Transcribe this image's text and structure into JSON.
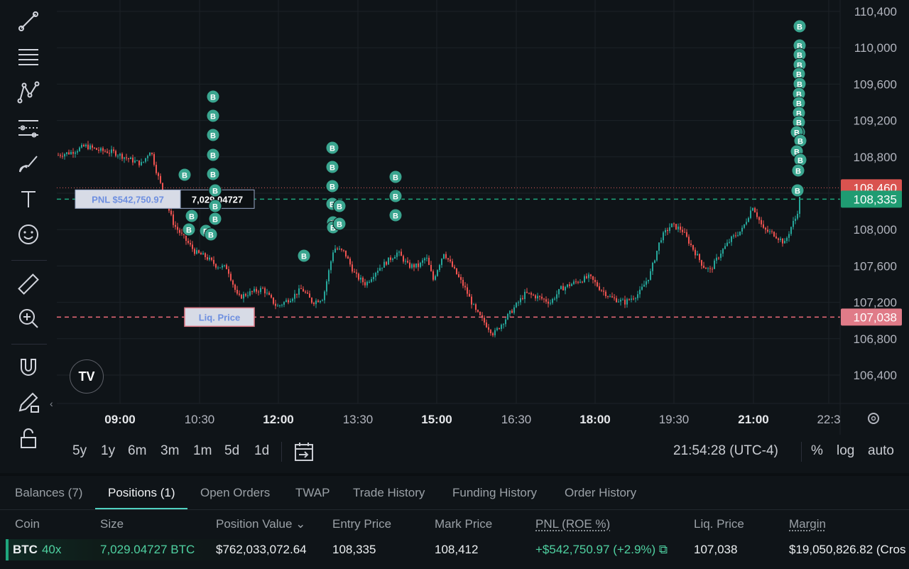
{
  "toolbar": {
    "tools": [
      "trend-line-icon",
      "horizontal-lines-icon",
      "pattern-icon",
      "fib-icon",
      "brush-icon",
      "text-icon",
      "emoji-icon",
      "ruler-icon",
      "zoom-in-icon",
      "magnet-icon",
      "pencil-lock-icon",
      "unlock-icon"
    ]
  },
  "chart": {
    "y_ticks": [
      "110,400",
      "110,000",
      "109,600",
      "109,200",
      "108,800",
      "108,000",
      "107,600",
      "107,200",
      "106,800",
      "106,400"
    ],
    "x_ticks": [
      {
        "label": "09:00",
        "bold": true
      },
      {
        "label": "10:30",
        "bold": false
      },
      {
        "label": "12:00",
        "bold": true
      },
      {
        "label": "13:30",
        "bold": false
      },
      {
        "label": "15:00",
        "bold": true
      },
      {
        "label": "16:30",
        "bold": false
      },
      {
        "label": "18:00",
        "bold": true
      },
      {
        "label": "19:30",
        "bold": false
      },
      {
        "label": "21:00",
        "bold": true
      },
      {
        "label": "22:3",
        "bold": false
      }
    ],
    "mark_price_label": "108,460",
    "entry_price_label": "108,335",
    "liq_price_label": "107,038",
    "pnl_tag": "PNL $542,750.97",
    "size_tag": "7,029.04727",
    "liq_tag": "Liq. Price",
    "trade_marker": "B",
    "colors": {
      "up": "#26a69a",
      "down": "#ef5350",
      "entry": "#1fa67d",
      "liq": "#f06b7a",
      "mark": "#e05c5c",
      "marker": "#3aa58f"
    }
  },
  "controls": {
    "ranges": [
      "5y",
      "1y",
      "6m",
      "3m",
      "1m",
      "5d",
      "1d"
    ],
    "clock": "21:54:28 (UTC-4)",
    "percent": "%",
    "log": "log",
    "auto": "auto"
  },
  "tabs": [
    {
      "label": "Balances (7)",
      "active": false
    },
    {
      "label": "Positions (1)",
      "active": true
    },
    {
      "label": "Open Orders",
      "active": false
    },
    {
      "label": "TWAP",
      "active": false
    },
    {
      "label": "Trade History",
      "active": false
    },
    {
      "label": "Funding History",
      "active": false
    },
    {
      "label": "Order History",
      "active": false
    }
  ],
  "table": {
    "headers": [
      "Coin",
      "Size",
      "Position Value",
      "Entry Price",
      "Mark Price",
      "PNL (ROE %)",
      "Liq. Price",
      "Margin"
    ],
    "row": {
      "coin": "BTC",
      "leverage": "40x",
      "size": "7,029.04727 BTC",
      "position_value": "$762,033,072.64",
      "entry_price": "108,335",
      "mark_price": "108,412",
      "pnl": "+$542,750.97 (+2.9%)",
      "liq_price": "107,038",
      "margin": "$19,050,826.82 (Cros"
    }
  }
}
